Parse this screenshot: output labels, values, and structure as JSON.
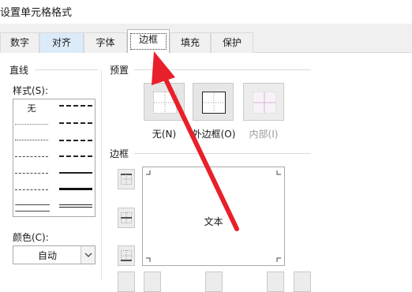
{
  "dialog": {
    "title": "设置单元格格式"
  },
  "tabs": [
    {
      "label": "数字"
    },
    {
      "label": "对齐"
    },
    {
      "label": "字体"
    },
    {
      "label": "边框"
    },
    {
      "label": "填充"
    },
    {
      "label": "保护"
    }
  ],
  "line": {
    "group_label": "直线",
    "style_label": "样式(S):",
    "style_none": "无",
    "color_label": "颜色(C):",
    "color_value": "自动"
  },
  "presets": {
    "group_label": "预置",
    "items": [
      {
        "label": "无(N)",
        "icon": "preset-none-icon"
      },
      {
        "label": "外边框(O)",
        "icon": "preset-outline-icon"
      },
      {
        "label": "内部(I)",
        "icon": "preset-inside-icon",
        "enabled": false
      }
    ]
  },
  "border": {
    "group_label": "边框",
    "preview_text": "文本"
  },
  "colors": {
    "accent_tab": "#dcebfa",
    "annotation_arrow": "#e8202a"
  }
}
